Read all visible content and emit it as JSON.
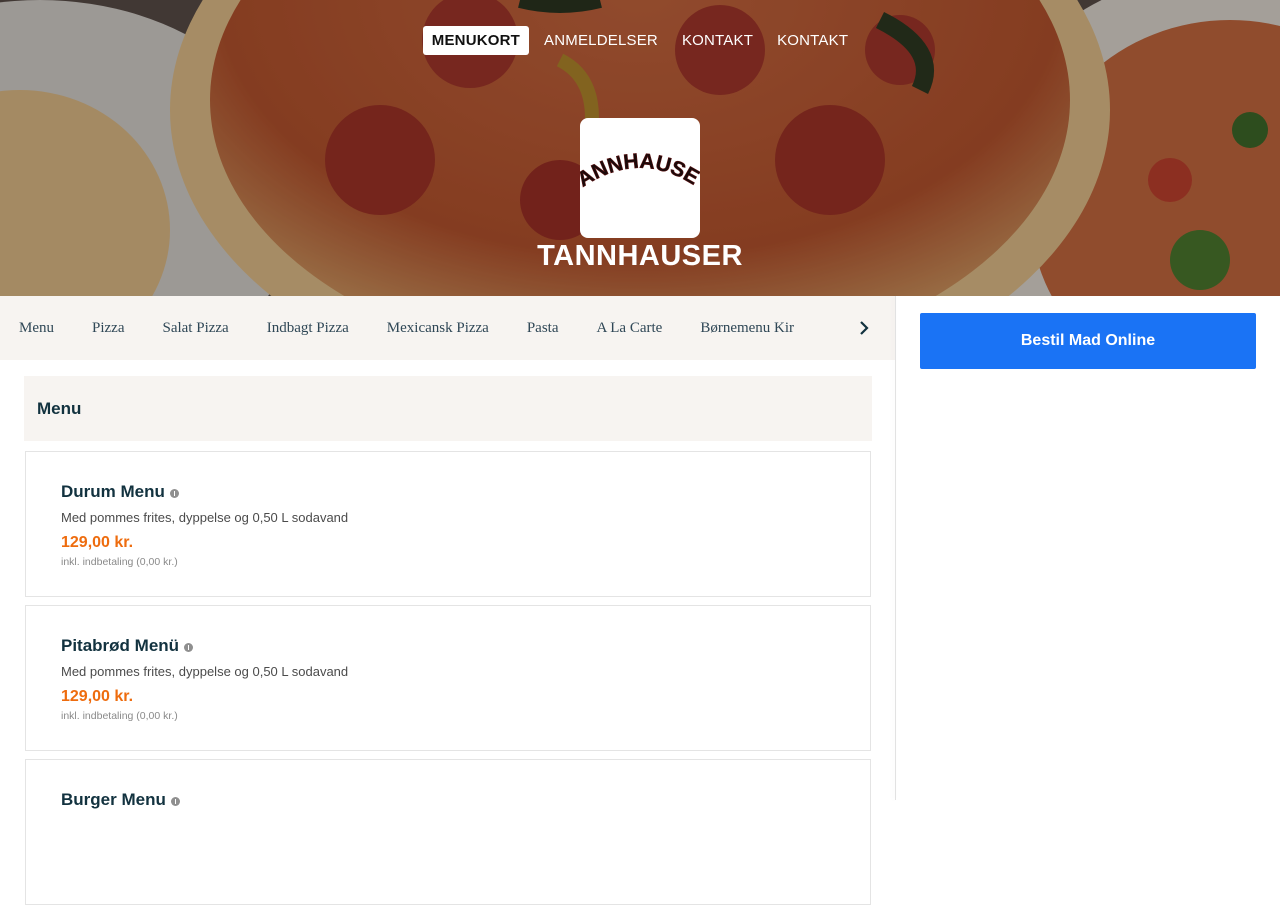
{
  "nav": {
    "items": [
      {
        "label": "MENUKORT",
        "active": true
      },
      {
        "label": "ANMELDELSER",
        "active": false
      },
      {
        "label": "KONTAKT",
        "active": false
      },
      {
        "label": "KONTAKT",
        "active": false
      }
    ]
  },
  "brand": {
    "logo_text": "TANNHAUSER",
    "name": "TANNHAUSER"
  },
  "categories": [
    "Menu",
    "Pizza",
    "Salat Pizza",
    "Indbagt Pizza",
    "Mexicansk Pizza",
    "Pasta",
    "A La Carte",
    "Børnemenu Kir"
  ],
  "section": {
    "title": "Menu"
  },
  "items": [
    {
      "name": "Durum Menu",
      "desc": "Med pommes frites, dyppelse og 0,50 L sodavand",
      "price": "129,00 kr.",
      "fee": "inkl. indbetaling (0,00 kr.)"
    },
    {
      "name": "Pitabrød Menü",
      "desc": "Med pommes frites, dyppelse og 0,50 L sodavand",
      "price": "129,00 kr.",
      "fee": "inkl. indbetaling (0,00 kr.)"
    },
    {
      "name": "Burger Menu",
      "desc": "",
      "price": "",
      "fee": ""
    }
  ],
  "sidebar": {
    "order_button": "Bestil Mad Online"
  },
  "colors": {
    "accent_blue": "#1a73f5",
    "price_orange": "#ee6c0e",
    "heading_dark": "#12323f",
    "panel_beige": "#f7f4f1"
  },
  "icons": {
    "info": "info-icon",
    "scroll_right": "chevron-right-icon"
  }
}
